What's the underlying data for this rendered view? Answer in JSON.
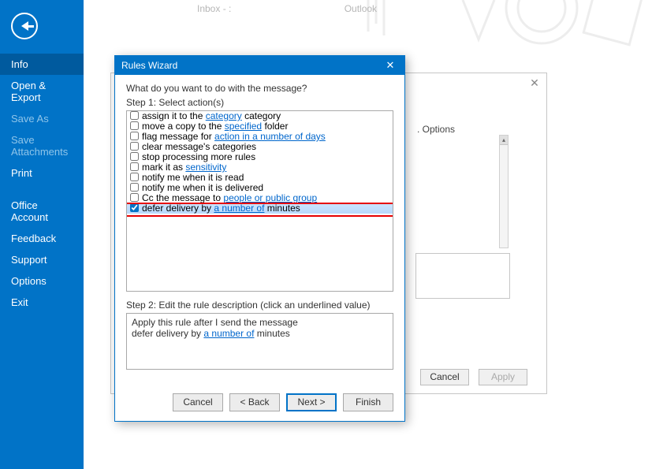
{
  "sidebar": {
    "items": [
      "Info",
      "Open & Export",
      "Save As",
      "Save Attachments",
      "Print",
      "Office Account",
      "Feedback",
      "Support",
      "Options",
      "Exit"
    ],
    "activeIndex": 0,
    "dimIndexes": [
      2,
      3
    ]
  },
  "topbar": {
    "inbox": "Inbox - :",
    "app": "Outlook"
  },
  "underDialog": {
    "options": "Options",
    "cancel": "Cancel",
    "apply": "Apply"
  },
  "wizard": {
    "title": "Rules Wizard",
    "question": "What do you want to do with the message?",
    "step1": "Step 1: Select action(s)",
    "actions": [
      {
        "pre": "assign it to the ",
        "link": "category",
        "post": " category",
        "checked": false
      },
      {
        "pre": "move a copy to the ",
        "link": "specified",
        "post": " folder",
        "checked": false
      },
      {
        "pre": "flag message for ",
        "link": "action in a number of days",
        "post": "",
        "checked": false
      },
      {
        "pre": "clear message's categories",
        "link": "",
        "post": "",
        "checked": false
      },
      {
        "pre": "stop processing more rules",
        "link": "",
        "post": "",
        "checked": false
      },
      {
        "pre": "mark it as ",
        "link": "sensitivity",
        "post": "",
        "checked": false
      },
      {
        "pre": "notify me when it is read",
        "link": "",
        "post": "",
        "checked": false
      },
      {
        "pre": "notify me when it is delivered",
        "link": "",
        "post": "",
        "checked": false
      },
      {
        "pre": "Cc the message to ",
        "link": "people or public group",
        "post": "",
        "checked": false
      },
      {
        "pre": "defer delivery by ",
        "link": "a number of",
        "post": " minutes",
        "checked": true,
        "highlight": true
      }
    ],
    "step2": "Step 2: Edit the rule description (click an underlined value)",
    "desc": {
      "line1": "Apply this rule after I send the message",
      "line2pre": "defer delivery by ",
      "line2link": "a number of",
      "line2post": " minutes"
    },
    "buttons": {
      "cancel": "Cancel",
      "back": "< Back",
      "next": "Next >",
      "finish": "Finish"
    }
  }
}
